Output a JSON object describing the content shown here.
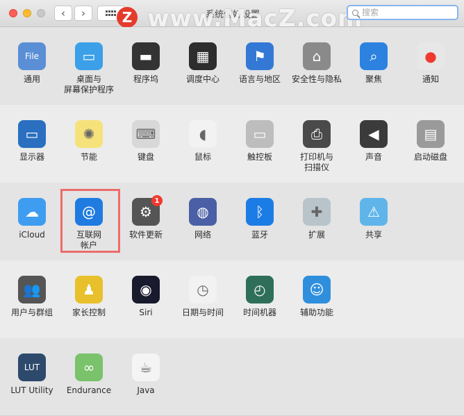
{
  "window": {
    "title": "系统偏好设置"
  },
  "search": {
    "placeholder": "搜索"
  },
  "watermark": {
    "badge": "Z",
    "text": "www.MacZ.com"
  },
  "rows": [
    [
      {
        "id": "general",
        "label": "通用",
        "icon": "general-icon",
        "color": "#5a8fd6"
      },
      {
        "id": "desktop",
        "label": "桌面与\n屏幕保护程序",
        "icon": "desktop-icon",
        "color": "#3ba0e8"
      },
      {
        "id": "dock",
        "label": "程序坞",
        "icon": "dock-icon",
        "color": "#333333"
      },
      {
        "id": "mission",
        "label": "调度中心",
        "icon": "mission-control-icon",
        "color": "#2d2d2d"
      },
      {
        "id": "language",
        "label": "语言与地区",
        "icon": "flag-icon",
        "color": "#3478d6"
      },
      {
        "id": "security",
        "label": "安全性与隐私",
        "icon": "house-lock-icon",
        "color": "#8a8a8a"
      },
      {
        "id": "spotlight",
        "label": "聚焦",
        "icon": "magnifier-icon",
        "color": "#2d82e0"
      },
      {
        "id": "notify",
        "label": "通知",
        "icon": "notification-icon",
        "color": "#e7e7e7"
      }
    ],
    [
      {
        "id": "display",
        "label": "显示器",
        "icon": "display-icon",
        "color": "#2a6fc0"
      },
      {
        "id": "energy",
        "label": "节能",
        "icon": "bulb-icon",
        "color": "#f6e27a"
      },
      {
        "id": "keyboard",
        "label": "键盘",
        "icon": "keyboard-icon",
        "color": "#d8d8d8"
      },
      {
        "id": "mouse",
        "label": "鼠标",
        "icon": "mouse-icon",
        "color": "#f2f2f2"
      },
      {
        "id": "trackpad",
        "label": "触控板",
        "icon": "trackpad-icon",
        "color": "#bdbdbd"
      },
      {
        "id": "printer",
        "label": "打印机与\n扫描仪",
        "icon": "printer-icon",
        "color": "#4a4a4a"
      },
      {
        "id": "sound",
        "label": "声音",
        "icon": "speaker-icon",
        "color": "#3b3b3b"
      },
      {
        "id": "startup",
        "label": "启动磁盘",
        "icon": "disk-icon",
        "color": "#9a9a9a"
      }
    ],
    [
      {
        "id": "icloud",
        "label": "iCloud",
        "icon": "cloud-icon",
        "color": "#3f9df1"
      },
      {
        "id": "internet",
        "label": "互联网\n帐户",
        "icon": "at-icon",
        "color": "#1f7be0"
      },
      {
        "id": "update",
        "label": "软件更新",
        "icon": "gear-icon",
        "color": "#555555",
        "badge": "1"
      },
      {
        "id": "network",
        "label": "网络",
        "icon": "globe-icon",
        "color": "#4a5fa5"
      },
      {
        "id": "bluetooth",
        "label": "蓝牙",
        "icon": "bluetooth-icon",
        "color": "#1c7ce5"
      },
      {
        "id": "extensions",
        "label": "扩展",
        "icon": "puzzle-icon",
        "color": "#b8c4c9"
      },
      {
        "id": "sharing",
        "label": "共享",
        "icon": "folder-icon",
        "color": "#5fb5ea"
      }
    ],
    [
      {
        "id": "users",
        "label": "用户与群组",
        "icon": "users-icon",
        "color": "#555555"
      },
      {
        "id": "parental",
        "label": "家长控制",
        "icon": "parental-icon",
        "color": "#e8c02b"
      },
      {
        "id": "siri",
        "label": "Siri",
        "icon": "siri-icon",
        "color": "#1a1a2e"
      },
      {
        "id": "datetime",
        "label": "日期与时间",
        "icon": "clock-icon",
        "color": "#f2f2f2"
      },
      {
        "id": "timemachine",
        "label": "时间机器",
        "icon": "time-machine-icon",
        "color": "#2f6f5a"
      },
      {
        "id": "access",
        "label": "辅助功能",
        "icon": "accessibility-icon",
        "color": "#2f8fdc"
      }
    ],
    [
      {
        "id": "lut",
        "label": "LUT Utility",
        "icon": "lut-icon",
        "color": "#2d4a6d"
      },
      {
        "id": "endurance",
        "label": "Endurance",
        "icon": "battery-icon",
        "color": "#7ac26b"
      },
      {
        "id": "java",
        "label": "Java",
        "icon": "java-icon",
        "color": "#f4f4f4"
      }
    ]
  ],
  "glyphs": {
    "general": "File",
    "desktop": "▭",
    "dock": "▬",
    "mission": "▦",
    "language": "⚑",
    "security": "⌂",
    "spotlight": "⌕",
    "notify": "●",
    "display": "▭",
    "energy": "✺",
    "keyboard": "⌨",
    "mouse": "◖",
    "trackpad": "▭",
    "printer": "⎙",
    "sound": "◀",
    "startup": "▤",
    "icloud": "☁",
    "internet": "@",
    "update": "⚙",
    "network": "◍",
    "bluetooth": "ᛒ",
    "extensions": "✚",
    "sharing": "⚠",
    "users": "👥",
    "parental": "♟",
    "siri": "◉",
    "datetime": "◷",
    "timemachine": "◴",
    "access": "☺",
    "lut": "LUT",
    "endurance": "∞",
    "java": "☕"
  }
}
